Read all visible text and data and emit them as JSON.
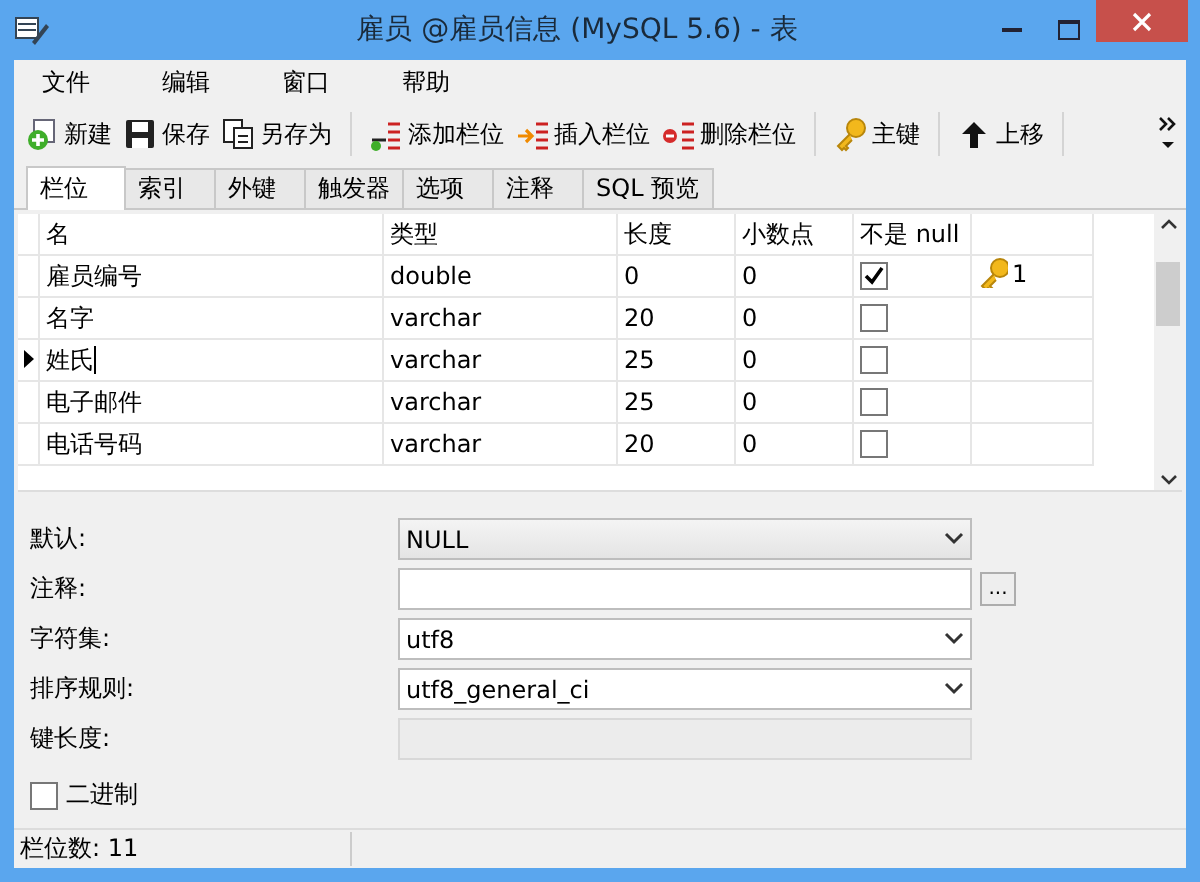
{
  "window": {
    "title": "雇员 @雇员信息 (MySQL 5.6) - 表"
  },
  "menu": [
    "文件",
    "编辑",
    "窗口",
    "帮助"
  ],
  "toolbar": [
    [
      {
        "label": "新建"
      },
      {
        "label": "保存"
      },
      {
        "label": "另存为"
      }
    ],
    [
      {
        "label": "添加栏位"
      },
      {
        "label": "插入栏位"
      },
      {
        "label": "删除栏位"
      }
    ],
    [
      {
        "label": "主键"
      }
    ],
    [
      {
        "label": "上移"
      }
    ]
  ],
  "tabs": [
    {
      "label": "栏位",
      "selected": true
    },
    {
      "label": "索引",
      "selected": false
    },
    {
      "label": "外键",
      "selected": false
    },
    {
      "label": "触发器",
      "selected": false
    },
    {
      "label": "选项",
      "selected": false
    },
    {
      "label": "注释",
      "selected": false
    },
    {
      "label": "SQL 预览",
      "selected": false
    }
  ],
  "table": {
    "columns": [
      "名",
      "类型",
      "长度",
      "小数点",
      "不是 null"
    ],
    "rows": [
      {
        "cells": [
          "雇员编号",
          "double",
          "0",
          "0"
        ],
        "not_null": true,
        "key": "1",
        "selected": false
      },
      {
        "cells": [
          "名字",
          "varchar",
          "20",
          "0"
        ],
        "not_null": false,
        "selected": false
      },
      {
        "cells": [
          "姓氏",
          "varchar",
          "25",
          "0"
        ],
        "not_null": false,
        "selected": true
      },
      {
        "cells": [
          "电子邮件",
          "varchar",
          "25",
          "0"
        ],
        "not_null": false,
        "selected": false
      },
      {
        "cells": [
          "电话号码",
          "varchar",
          "20",
          "0"
        ],
        "not_null": false,
        "selected": false
      }
    ]
  },
  "properties": [
    {
      "label": "默认:",
      "kind": "select",
      "value": "NULL"
    },
    {
      "label": "注释:",
      "kind": "text",
      "button": "..."
    },
    {
      "label": "字符集:",
      "kind": "select",
      "value": "utf8"
    },
    {
      "label": "排序规则:",
      "kind": "select",
      "value": "utf8_general_ci"
    },
    {
      "label": "键长度:",
      "kind": "disabled"
    }
  ],
  "binary": {
    "label": "二进制",
    "checked": false
  },
  "status_bar": "栏位数: 11"
}
